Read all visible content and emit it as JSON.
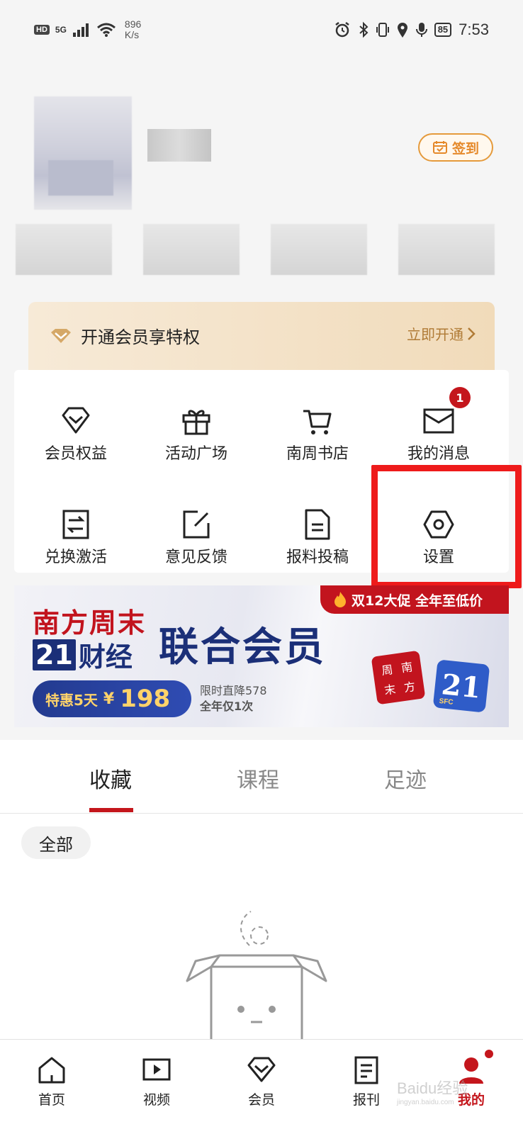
{
  "status_bar": {
    "hd": "HD",
    "network": "5G",
    "speed_value": "896",
    "speed_unit": "K/s",
    "battery": "85",
    "time": "7:53"
  },
  "profile": {
    "checkin_label": "签到"
  },
  "vip": {
    "title": "开通会员享特权",
    "action": "立即开通"
  },
  "shortcuts": [
    {
      "label": "会员权益",
      "icon": "diamond-icon"
    },
    {
      "label": "活动广场",
      "icon": "gift-icon"
    },
    {
      "label": "南周书店",
      "icon": "cart-icon"
    },
    {
      "label": "我的消息",
      "icon": "mail-icon",
      "badge": "1"
    },
    {
      "label": "兑换激活",
      "icon": "exchange-icon"
    },
    {
      "label": "意见反馈",
      "icon": "edit-icon"
    },
    {
      "label": "报料投稿",
      "icon": "document-icon"
    },
    {
      "label": "设置",
      "icon": "settings-hexagon-icon"
    }
  ],
  "banner": {
    "promo": "双12大促 全年至低价",
    "brand1": "南方周末",
    "brand2_num": "21",
    "brand2_text": "财经",
    "title": "联合会员",
    "price_label": "特惠5天",
    "price_currency": "¥",
    "price_value": "198",
    "note1": "限时直降578",
    "note2": "全年仅1次",
    "logo1_chars": [
      "周",
      "南",
      "末",
      "方"
    ],
    "logo2_num": "21",
    "logo2_sub": "SFC"
  },
  "tabs": [
    {
      "label": "收藏",
      "active": true
    },
    {
      "label": "课程",
      "active": false
    },
    {
      "label": "足迹",
      "active": false
    }
  ],
  "filter_chip": "全部",
  "bottom_nav": [
    {
      "label": "首页",
      "icon": "home-icon"
    },
    {
      "label": "视频",
      "icon": "video-icon"
    },
    {
      "label": "会员",
      "icon": "diamond-icon"
    },
    {
      "label": "报刊",
      "icon": "newspaper-icon"
    },
    {
      "label": "我的",
      "icon": "profile-icon",
      "active": true
    }
  ],
  "watermark": {
    "main": "Baidu经验",
    "sub": "jingyan.baidu.com"
  },
  "colors": {
    "accent": "#c4161c",
    "vip_gold": "#b07b36",
    "checkin": "#e5892a",
    "highlight": "#ee1b1b"
  }
}
